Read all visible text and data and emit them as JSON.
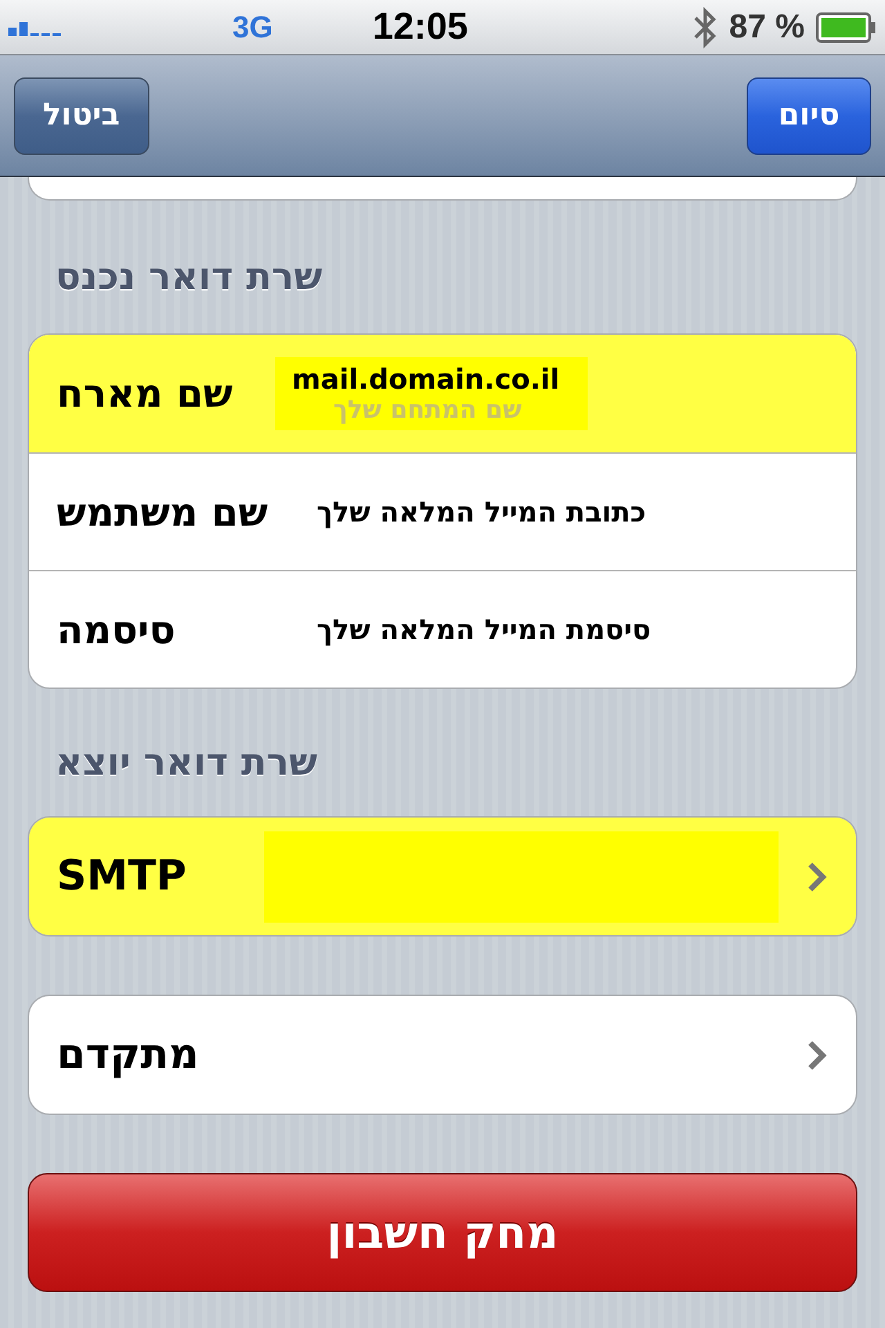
{
  "status_bar": {
    "network": "3G",
    "time": "12:05",
    "battery": "87 %"
  },
  "nav_bar": {
    "left_button": "ביטול",
    "right_button": "סיום"
  },
  "sections": [
    {
      "header": "שרת דואר נכנס",
      "rows": [
        {
          "kind": "field",
          "label": "שם מארח",
          "value": "mail.domain.co.il",
          "hint": "שם המתחם שלך",
          "highlighted": true
        },
        {
          "kind": "field",
          "label": "שם משתמש",
          "value": "כתובת המייל המלאה שלך",
          "highlighted": false
        },
        {
          "kind": "field",
          "label": "סיסמה",
          "value": "סיסמת המייל המלאה שלך",
          "highlighted": false
        }
      ]
    },
    {
      "header": "שרת דואר יוצא",
      "rows": [
        {
          "kind": "link",
          "label": "SMTP",
          "highlighted": true
        }
      ]
    },
    {
      "rows": [
        {
          "kind": "link",
          "label": "מתקדם",
          "highlighted": false
        }
      ]
    }
  ],
  "delete_button": "מחק חשבון"
}
